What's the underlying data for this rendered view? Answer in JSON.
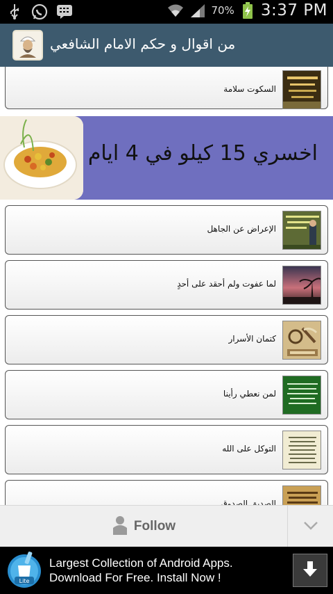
{
  "status_bar": {
    "icons_left": [
      "usb-icon",
      "whatsapp-icon",
      "bbm-icon"
    ],
    "icons_right": [
      "wifi-icon",
      "signal-icon",
      "battery-icon"
    ],
    "battery_percent": "70%",
    "time": "3:37 PM"
  },
  "action_bar": {
    "title": "من اقوال و حكم الامام الشافعي",
    "logo_icon": "imam-portrait-icon"
  },
  "list": {
    "items": [
      {
        "label": "السكوت سلامة",
        "thumb_color": "#6b5a2a"
      },
      {
        "label": "الإعراض عن الجاهل",
        "thumb_color": "#58613a"
      },
      {
        "label": "لما عفوت ولم أحقد على أحدٍ",
        "thumb_color": "#4a3d3a"
      },
      {
        "label": "كتمان الأسرار",
        "thumb_color": "#b89a5e"
      },
      {
        "label": "لمن نعطي رأينا",
        "thumb_color": "#1f6b22"
      },
      {
        "label": "التوكل على الله",
        "thumb_color": "#e9e4c8"
      },
      {
        "label": "الصديق الصدوق",
        "thumb_color": "#c9a055"
      }
    ]
  },
  "banner": {
    "text": "اخسري 15 كيلو في 4 ايام",
    "bg_color": "#6f6fbf"
  },
  "follow_bar": {
    "label": "Follow",
    "user_icon": "user-icon",
    "chevron_icon": "chevron-down-icon"
  },
  "bottom_ad": {
    "line1": "Largest Collection of Android Apps.",
    "line2": "Download For Free. Install Now !",
    "logo_icon": "lite-app-logo-icon",
    "download_icon": "download-arrow-icon"
  }
}
